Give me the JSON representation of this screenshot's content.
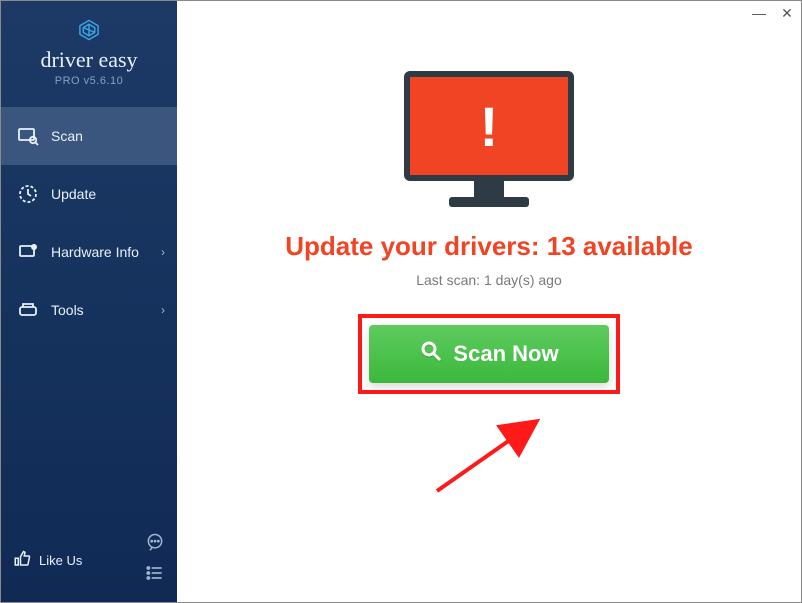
{
  "brand": {
    "name": "driver easy",
    "sub": "PRO v5.6.10"
  },
  "window_controls": {
    "minimize": "—",
    "close": "✕"
  },
  "sidebar": {
    "items": [
      {
        "label": "Scan",
        "has_chevron": false,
        "active": true
      },
      {
        "label": "Update",
        "has_chevron": false,
        "active": false
      },
      {
        "label": "Hardware Info",
        "has_chevron": true,
        "active": false
      },
      {
        "label": "Tools",
        "has_chevron": true,
        "active": false
      }
    ],
    "like_label": "Like Us"
  },
  "main": {
    "headline": "Update your drivers: 13 available",
    "subline": "Last scan: 1 day(s) ago",
    "scan_button": "Scan Now"
  },
  "colors": {
    "sidebar_bg": "#14315c",
    "accent_orange": "#f14424",
    "highlight_red": "#ff1a1a",
    "button_green": "#3cb83c"
  }
}
